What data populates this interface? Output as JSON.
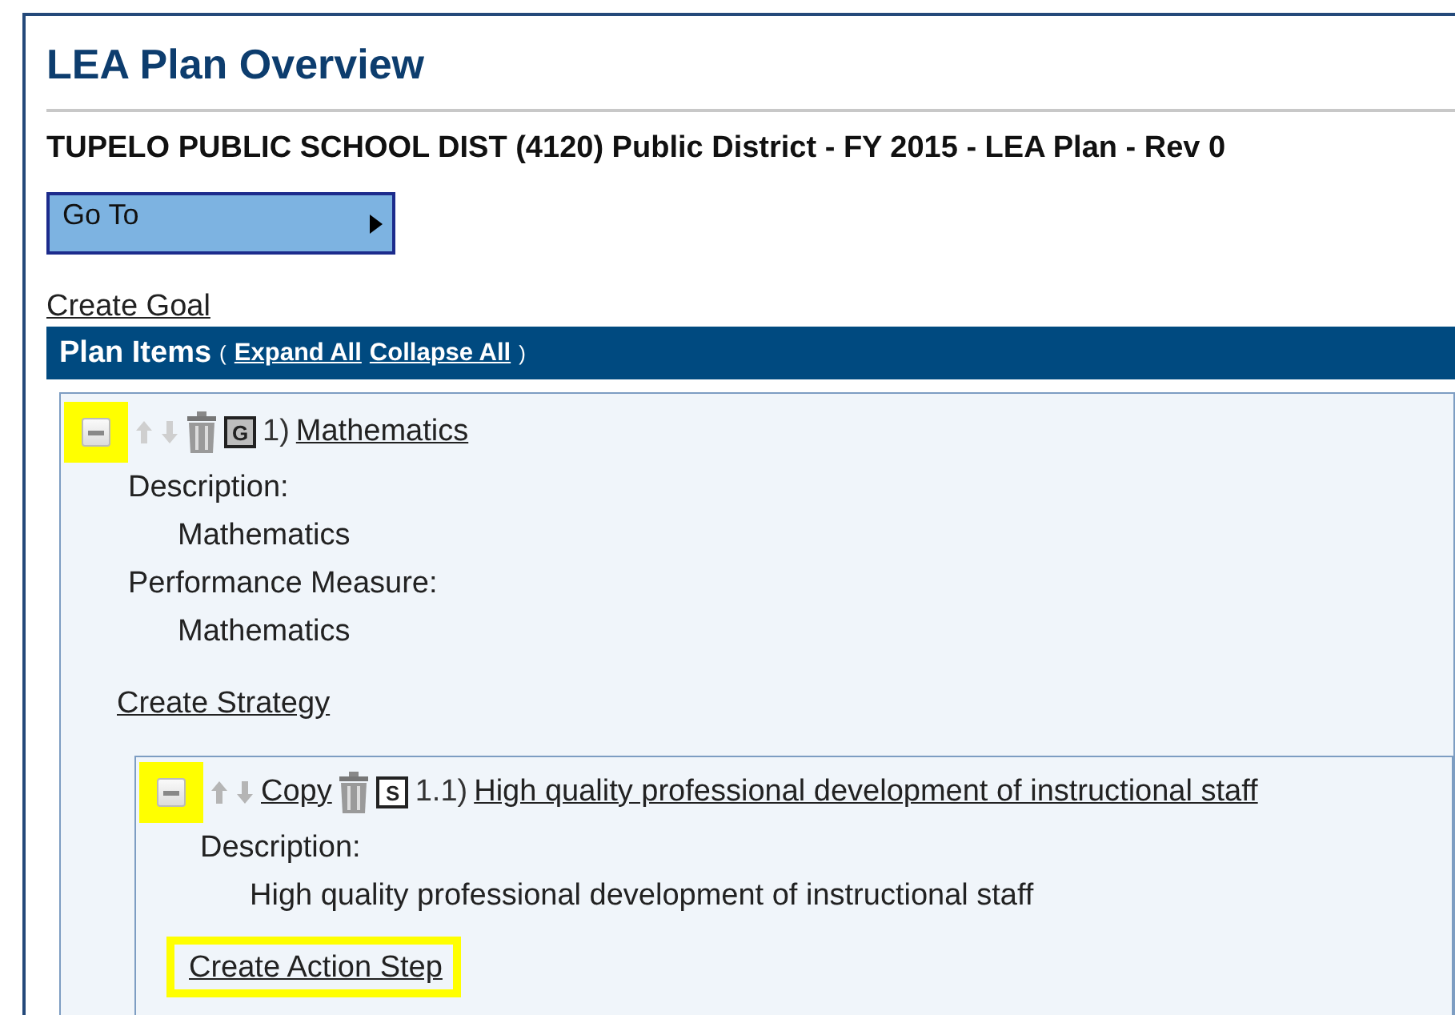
{
  "page": {
    "title": "LEA Plan Overview",
    "subtitle": "TUPELO PUBLIC SCHOOL DIST (4120) Public District - FY 2015 - LEA Plan - Rev 0",
    "goto_button": "Go To",
    "create_goal": "Create Goal"
  },
  "plan_items": {
    "title": "Plan Items",
    "open_paren": "(",
    "expand_all": "Expand All",
    "collapse_all": "Collapse All",
    "close_paren": ")"
  },
  "items": [
    {
      "kind": "goal",
      "badge": "G",
      "number": "1)",
      "title": "Mathematics",
      "expanded": true,
      "collapse_highlighted": true,
      "fields": [
        {
          "label": "Description:",
          "value": "Mathematics"
        },
        {
          "label": "Performance Measure:",
          "value": "Mathematics"
        }
      ],
      "create_link": {
        "label": "Create Strategy",
        "highlighted": false
      },
      "children": [
        {
          "kind": "strategy",
          "copy": "Copy",
          "badge": "S",
          "number": "1.1)",
          "title": "High quality professional development of instructional staff",
          "expanded": true,
          "collapse_highlighted": true,
          "fields": [
            {
              "label": "Description:",
              "value": "High quality professional development of instructional staff"
            }
          ],
          "create_link": {
            "label": "Create Action Step",
            "highlighted": true
          }
        }
      ]
    }
  ]
}
